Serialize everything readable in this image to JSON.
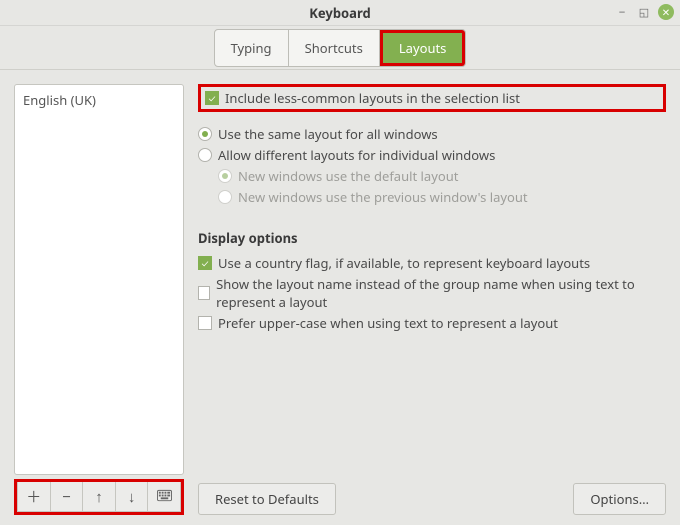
{
  "window": {
    "title": "Keyboard"
  },
  "tabs": {
    "typing": "Typing",
    "shortcuts": "Shortcuts",
    "layouts": "Layouts"
  },
  "sidebar": {
    "items": [
      "English (UK)"
    ]
  },
  "options": {
    "include_less_common": "Include less-common layouts in the selection list",
    "use_same_layout": "Use the same layout for all windows",
    "allow_different": "Allow different layouts for individual windows",
    "new_default": "New windows use the default layout",
    "new_previous": "New windows use the previous window's layout"
  },
  "display": {
    "heading": "Display options",
    "country_flag": "Use a country flag, if available,  to represent keyboard layouts",
    "show_layout_name": "Show the layout name instead of the group name when using text to represent a layout",
    "prefer_upper": "Prefer upper-case when using text to represent a layout"
  },
  "footer": {
    "reset": "Reset to Defaults",
    "options": "Options…"
  }
}
